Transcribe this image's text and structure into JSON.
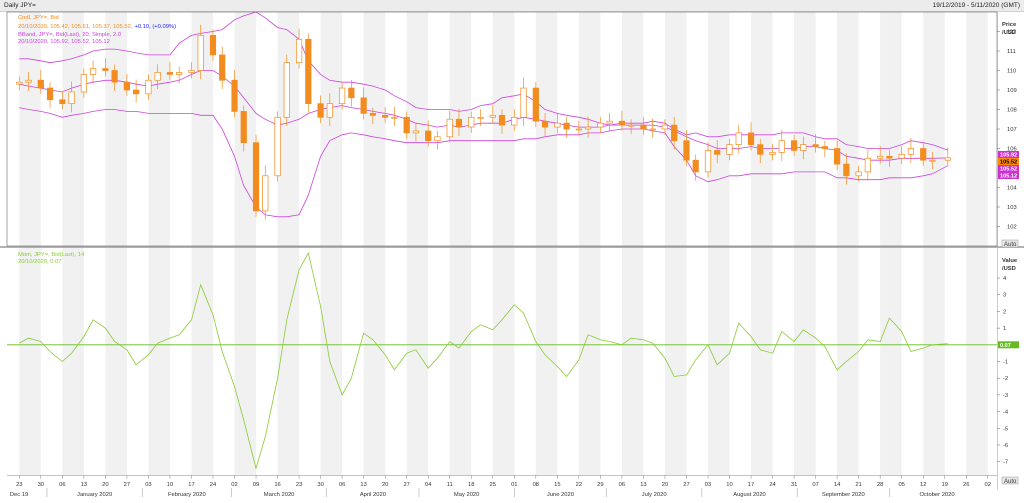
{
  "window": {
    "title": "Daily JPY=",
    "date_range": "19/12/2019 - 5/11/2020 (GMT)"
  },
  "price_pane": {
    "legend": {
      "series_line": "Cndl, JPY=, Bid",
      "ohlc_line_prefix": "20/10/2020, 105.42, 105.61, 105.37, 105.52,",
      "change": "+0.10, (+0.09%)",
      "bband_line": "BBand, JPY=, Bid(Last), 20, Simple, 2.0",
      "bband_values": "20/10/2020, 105.92, 105.52, 105.12"
    },
    "axis_title": [
      "Price",
      "/USD"
    ],
    "yticks": [
      "112",
      "111",
      "110",
      "109",
      "108",
      "107",
      "106",
      "104",
      "103",
      "102"
    ],
    "tags": [
      "105.92",
      "105.52",
      "105.52",
      "105.12"
    ],
    "auto_label": "Auto"
  },
  "momentum_pane": {
    "legend": {
      "series_line": "Mom, JPY=, Bid(Last), 14",
      "value_line": "20/10/2020, 0.07"
    },
    "axis_title": [
      "Value",
      "/USD"
    ],
    "yticks": [
      "4",
      "3",
      "2",
      "1",
      "-1",
      "-2",
      "-3",
      "-4",
      "-5",
      "-6",
      "-7"
    ],
    "tag": "0.07",
    "auto_label": "Auto"
  },
  "x_axis": {
    "day_ticks": [
      "23",
      "30",
      "06",
      "13",
      "20",
      "27",
      "03",
      "10",
      "17",
      "24",
      "02",
      "09",
      "16",
      "23",
      "30",
      "06",
      "13",
      "20",
      "27",
      "04",
      "11",
      "18",
      "25",
      "01",
      "08",
      "15",
      "22",
      "29",
      "06",
      "13",
      "20",
      "27",
      "03",
      "10",
      "17",
      "24",
      "31",
      "07",
      "14",
      "21",
      "28",
      "05",
      "12",
      "19",
      "26",
      "02"
    ],
    "month_labels": [
      "Dec 19",
      "January 2020",
      "February 2020",
      "March 2020",
      "April 2020",
      "May 2020",
      "June 2020",
      "July 2020",
      "August 2020",
      "September 2020",
      "October 2020"
    ]
  },
  "colors": {
    "candle": "#f28c1e",
    "bband": "#cc44dd",
    "momentum": "#88cc33",
    "zero_line": "#66bb22",
    "change": "#1a1aff",
    "tag_upper": "#cc33cc",
    "tag_last": "#ff8800",
    "tag_mom": "#66bb22"
  },
  "chart_data": [
    {
      "type": "candlestick",
      "title": "Daily JPY=",
      "ylabel": "Price /USD",
      "ylim": [
        101,
        113
      ],
      "x": [
        "2019-12-23",
        "2019-12-26",
        "2019-12-30",
        "2020-01-02",
        "2020-01-06",
        "2020-01-09",
        "2020-01-13",
        "2020-01-16",
        "2020-01-20",
        "2020-01-23",
        "2020-01-27",
        "2020-01-30",
        "2020-02-03",
        "2020-02-06",
        "2020-02-10",
        "2020-02-13",
        "2020-02-17",
        "2020-02-20",
        "2020-02-24",
        "2020-02-27",
        "2020-03-02",
        "2020-03-05",
        "2020-03-09",
        "2020-03-12",
        "2020-03-16",
        "2020-03-19",
        "2020-03-23",
        "2020-03-26",
        "2020-03-30",
        "2020-04-02",
        "2020-04-06",
        "2020-04-09",
        "2020-04-13",
        "2020-04-16",
        "2020-04-20",
        "2020-04-23",
        "2020-04-27",
        "2020-04-30",
        "2020-05-04",
        "2020-05-07",
        "2020-05-11",
        "2020-05-14",
        "2020-05-18",
        "2020-05-21",
        "2020-05-25",
        "2020-05-28",
        "2020-06-01",
        "2020-06-04",
        "2020-06-08",
        "2020-06-11",
        "2020-06-15",
        "2020-06-18",
        "2020-06-22",
        "2020-06-25",
        "2020-06-29",
        "2020-07-02",
        "2020-07-06",
        "2020-07-09",
        "2020-07-13",
        "2020-07-16",
        "2020-07-20",
        "2020-07-23",
        "2020-07-27",
        "2020-07-30",
        "2020-08-03",
        "2020-08-06",
        "2020-08-10",
        "2020-08-13",
        "2020-08-17",
        "2020-08-20",
        "2020-08-24",
        "2020-08-27",
        "2020-08-31",
        "2020-09-03",
        "2020-09-07",
        "2020-09-10",
        "2020-09-14",
        "2020-09-17",
        "2020-09-21",
        "2020-09-24",
        "2020-09-28",
        "2020-10-01",
        "2020-10-05",
        "2020-10-08",
        "2020-10-12",
        "2020-10-15",
        "2020-10-20"
      ],
      "close": [
        109.4,
        109.5,
        109.1,
        108.5,
        108.3,
        108.9,
        109.8,
        110.1,
        110.0,
        109.4,
        109.0,
        108.8,
        109.5,
        109.9,
        109.8,
        109.9,
        110.0,
        111.8,
        110.8,
        109.5,
        107.9,
        106.3,
        102.8,
        104.6,
        107.6,
        110.4,
        111.6,
        108.3,
        107.6,
        108.3,
        109.1,
        108.6,
        107.8,
        107.7,
        107.6,
        107.6,
        106.8,
        106.9,
        106.4,
        106.6,
        107.5,
        107.1,
        107.6,
        107.6,
        107.7,
        107.2,
        107.6,
        109.1,
        107.4,
        107.1,
        107.3,
        107.0,
        107.0,
        107.1,
        107.3,
        107.4,
        107.2,
        107.2,
        107.0,
        107.0,
        107.2,
        106.4,
        105.4,
        104.8,
        105.9,
        105.7,
        106.2,
        106.8,
        106.2,
        105.7,
        105.8,
        106.4,
        105.9,
        106.2,
        106.1,
        106.0,
        105.2,
        104.6,
        104.8,
        105.5,
        105.6,
        105.5,
        105.7,
        106.0,
        105.4,
        105.4,
        105.52
      ],
      "bband_upper": [
        110.6,
        110.6,
        110.5,
        110.4,
        110.5,
        110.6,
        110.8,
        111.0,
        111.1,
        111.1,
        111.0,
        110.9,
        110.8,
        110.8,
        110.8,
        111.4,
        111.8,
        111.9,
        112.0,
        112.1,
        112.6,
        112.8,
        113.0,
        112.7,
        112.2,
        112.1,
        111.6,
        110.5,
        109.8,
        109.5,
        109.4,
        109.4,
        109.3,
        109.2,
        109.0,
        108.7,
        108.4,
        108.1,
        108.0,
        108.0,
        108.0,
        107.9,
        108.0,
        108.2,
        108.3,
        108.6,
        108.7,
        108.8,
        108.4,
        108.0,
        107.8,
        107.7,
        107.6,
        107.5,
        107.3,
        107.2,
        107.3,
        107.3,
        107.3,
        107.4,
        107.3,
        107.0,
        106.7,
        106.8,
        106.6,
        106.6,
        106.7,
        106.7,
        106.7,
        106.7,
        106.7,
        106.8,
        106.8,
        106.8,
        106.6,
        106.5,
        106.5,
        106.2,
        106.1,
        106.0,
        106.0,
        106.0,
        106.2,
        106.4,
        106.3,
        106.2,
        105.92
      ],
      "bband_middle": [
        109.3,
        109.2,
        109.1,
        109.0,
        108.9,
        109.1,
        109.3,
        109.4,
        109.5,
        109.5,
        109.4,
        109.3,
        109.2,
        109.3,
        109.4,
        109.5,
        109.8,
        110.0,
        110.0,
        109.7,
        109.2,
        108.6,
        107.8,
        107.5,
        107.2,
        107.3,
        107.5,
        107.8,
        108.0,
        108.1,
        108.2,
        108.1,
        108.0,
        107.9,
        107.8,
        107.7,
        107.5,
        107.3,
        107.2,
        107.1,
        107.2,
        107.1,
        107.2,
        107.3,
        107.3,
        107.3,
        107.5,
        107.6,
        107.5,
        107.4,
        107.3,
        107.2,
        107.1,
        107.1,
        107.1,
        107.2,
        107.2,
        107.2,
        107.2,
        107.2,
        107.1,
        106.9,
        106.6,
        106.4,
        106.2,
        106.0,
        106.0,
        106.0,
        106.1,
        106.0,
        106.0,
        106.0,
        106.0,
        106.1,
        106.1,
        106.0,
        105.9,
        105.6,
        105.5,
        105.4,
        105.4,
        105.4,
        105.5,
        105.5,
        105.5,
        105.5,
        105.52
      ],
      "bband_lower": [
        108.1,
        108.0,
        107.9,
        107.8,
        107.6,
        107.7,
        107.8,
        107.9,
        108.0,
        108.0,
        107.9,
        107.9,
        107.8,
        107.8,
        107.8,
        107.8,
        107.8,
        107.7,
        107.7,
        107.0,
        105.6,
        104.1,
        103.0,
        102.6,
        102.5,
        102.5,
        102.6,
        103.6,
        105.6,
        106.4,
        106.7,
        106.8,
        106.7,
        106.6,
        106.5,
        106.4,
        106.3,
        106.3,
        106.3,
        106.3,
        106.4,
        106.4,
        106.4,
        106.4,
        106.4,
        106.4,
        106.4,
        106.5,
        106.5,
        106.6,
        106.7,
        106.7,
        106.7,
        106.8,
        106.8,
        106.9,
        107.0,
        107.0,
        107.0,
        106.9,
        106.8,
        106.1,
        105.4,
        104.6,
        104.3,
        104.4,
        104.6,
        104.6,
        104.7,
        104.7,
        104.7,
        104.7,
        104.8,
        104.8,
        104.8,
        104.8,
        104.5,
        104.5,
        104.4,
        104.4,
        104.4,
        104.5,
        104.5,
        104.5,
        104.6,
        104.7,
        105.12
      ]
    },
    {
      "type": "line",
      "title": "Mom, JPY=, Bid(Last), 14",
      "ylabel": "Value /USD",
      "ylim": [
        -7.8,
        5.8
      ],
      "x": [
        "2019-12-23",
        "2019-12-26",
        "2019-12-30",
        "2020-01-02",
        "2020-01-06",
        "2020-01-09",
        "2020-01-13",
        "2020-01-16",
        "2020-01-20",
        "2020-01-23",
        "2020-01-27",
        "2020-01-30",
        "2020-02-03",
        "2020-02-06",
        "2020-02-10",
        "2020-02-13",
        "2020-02-17",
        "2020-02-20",
        "2020-02-24",
        "2020-02-27",
        "2020-03-02",
        "2020-03-05",
        "2020-03-09",
        "2020-03-12",
        "2020-03-16",
        "2020-03-19",
        "2020-03-23",
        "2020-03-26",
        "2020-03-30",
        "2020-04-02",
        "2020-04-06",
        "2020-04-09",
        "2020-04-13",
        "2020-04-16",
        "2020-04-20",
        "2020-04-23",
        "2020-04-27",
        "2020-04-30",
        "2020-05-04",
        "2020-05-07",
        "2020-05-11",
        "2020-05-14",
        "2020-05-18",
        "2020-05-21",
        "2020-05-25",
        "2020-05-28",
        "2020-06-01",
        "2020-06-04",
        "2020-06-08",
        "2020-06-11",
        "2020-06-15",
        "2020-06-18",
        "2020-06-22",
        "2020-06-25",
        "2020-06-29",
        "2020-07-02",
        "2020-07-06",
        "2020-07-09",
        "2020-07-13",
        "2020-07-16",
        "2020-07-20",
        "2020-07-23",
        "2020-07-27",
        "2020-07-30",
        "2020-08-03",
        "2020-08-06",
        "2020-08-10",
        "2020-08-13",
        "2020-08-17",
        "2020-08-20",
        "2020-08-24",
        "2020-08-27",
        "2020-08-31",
        "2020-09-03",
        "2020-09-07",
        "2020-09-10",
        "2020-09-14",
        "2020-09-17",
        "2020-09-21",
        "2020-09-24",
        "2020-09-28",
        "2020-10-01",
        "2020-10-05",
        "2020-10-08",
        "2020-10-12",
        "2020-10-15",
        "2020-10-20"
      ],
      "values": [
        0.1,
        0.4,
        0.2,
        -0.4,
        -1.0,
        -0.5,
        0.5,
        1.5,
        1.0,
        0.2,
        -0.3,
        -1.2,
        -0.6,
        0.1,
        0.4,
        0.6,
        1.5,
        3.6,
        1.8,
        -0.4,
        -2.5,
        -4.5,
        -7.4,
        -5.5,
        -2.0,
        1.5,
        4.5,
        5.5,
        2.3,
        -1.0,
        -3.0,
        -2.0,
        0.7,
        0.3,
        -0.6,
        -1.5,
        -0.5,
        -0.3,
        -1.4,
        -0.8,
        0.2,
        -0.2,
        0.8,
        1.2,
        0.9,
        1.5,
        2.4,
        1.9,
        0.2,
        -0.6,
        -1.3,
        -1.9,
        -0.9,
        0.6,
        0.3,
        0.2,
        0.0,
        0.4,
        0.3,
        0.1,
        -0.8,
        -1.9,
        -1.8,
        -0.9,
        0.0,
        -1.2,
        -0.5,
        1.3,
        0.5,
        -0.3,
        -0.5,
        0.8,
        0.2,
        0.9,
        0.4,
        -0.1,
        -1.5,
        -1.0,
        -0.4,
        0.3,
        0.2,
        1.6,
        0.8,
        -0.4,
        -0.2,
        0.0,
        0.07
      ]
    }
  ]
}
